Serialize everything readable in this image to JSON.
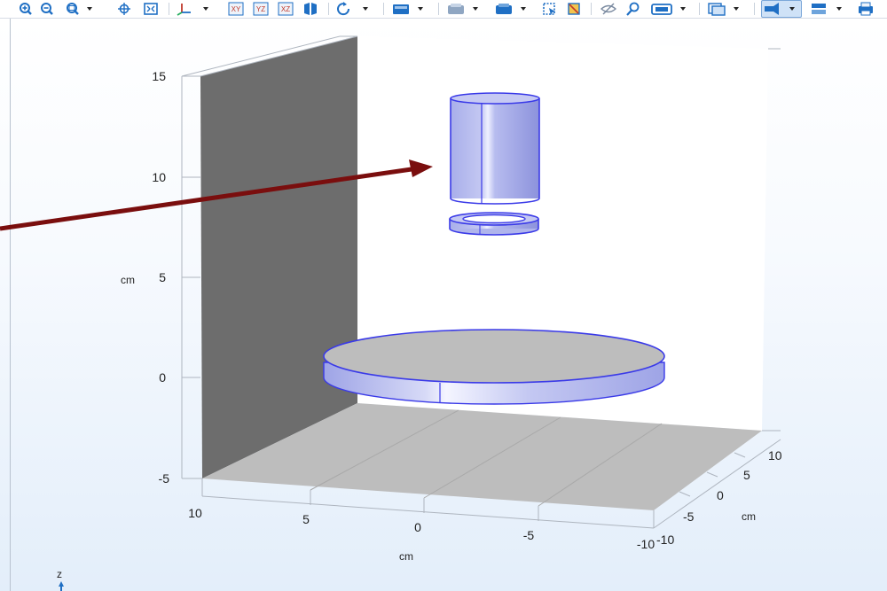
{
  "toolbar": {
    "buttons": [
      {
        "name": "zoom-in-icon",
        "active": false
      },
      {
        "name": "zoom-out-icon",
        "active": false
      },
      {
        "name": "zoom-box-icon",
        "active": false,
        "dropdown": true
      },
      {
        "name": "zoom-selected-icon",
        "active": false
      },
      {
        "name": "zoom-extents-icon",
        "active": false
      },
      {
        "name": "view-axes-icon",
        "active": false,
        "dropdown": true
      },
      {
        "name": "xy-plane-icon",
        "text": "XY",
        "active": false
      },
      {
        "name": "yz-plane-icon",
        "text": "YZ",
        "active": false
      },
      {
        "name": "xz-plane-icon",
        "text": "XZ",
        "active": false
      },
      {
        "name": "split-view-icon",
        "active": false
      },
      {
        "name": "rotate-icon",
        "active": false,
        "dropdown": true
      },
      {
        "name": "scene-light-icon",
        "active": false,
        "dropdown": true
      },
      {
        "name": "transparency-icon",
        "active": false,
        "dropdown": true
      },
      {
        "name": "wireframe-icon",
        "active": false,
        "dropdown": true
      },
      {
        "name": "select-box-icon",
        "active": false
      },
      {
        "name": "deselect-box-icon",
        "active": false
      },
      {
        "name": "hide-icon",
        "active": false
      },
      {
        "name": "find-icon",
        "active": false
      },
      {
        "name": "view-settings-icon",
        "active": false,
        "dropdown": true
      },
      {
        "name": "image-snapshot-icon",
        "active": false,
        "dropdown": true
      },
      {
        "name": "geometry-view-icon",
        "active": true,
        "dropdown": true
      },
      {
        "name": "layers-icon",
        "active": false,
        "dropdown": true
      },
      {
        "name": "print-icon",
        "active": false
      }
    ]
  },
  "axes": {
    "z_ticks": [
      "15",
      "10",
      "5",
      "0",
      "-5"
    ],
    "z_unit": "cm",
    "x_ticks": [
      "10",
      "5",
      "0",
      "-5",
      "-10"
    ],
    "x_unit": "cm",
    "y_ticks": [
      "10",
      "5",
      "0",
      "-5",
      "-10"
    ],
    "y_unit": "cm",
    "triad_label": "z"
  },
  "colors": {
    "geometry_face": "#b4b8ee",
    "geometry_edge": "#3a3ae8",
    "disk_top": "#bcbcbc",
    "back_wall": "#6b6b6b",
    "floor": "#bdbdbd",
    "arrow": "#7a0e0e",
    "toolbar_icon": "#1f6fc4"
  }
}
